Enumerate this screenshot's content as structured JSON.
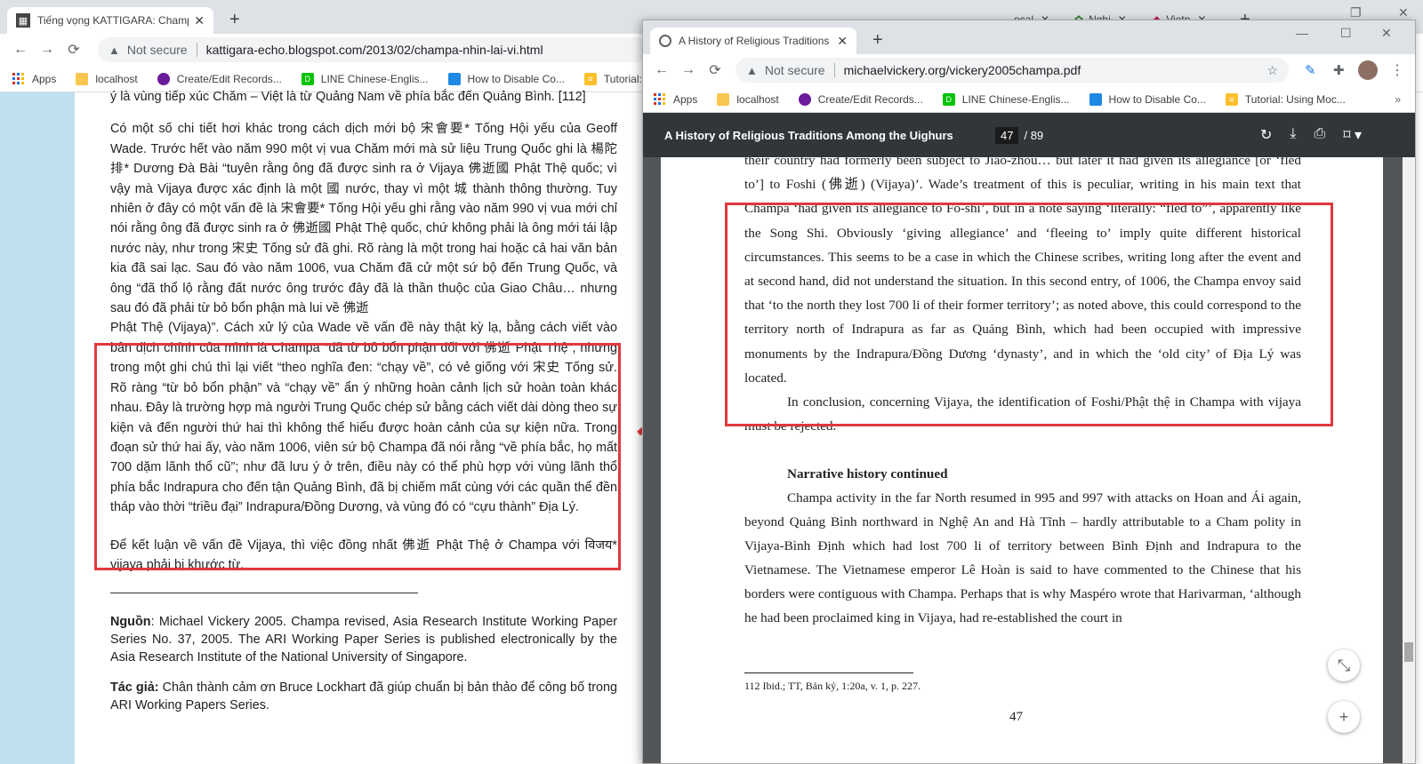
{
  "back_window": {
    "tab_title": "Tiếng vọng KATTIGARA: Champa",
    "url_security": "Not secure",
    "url": "kattigara-echo.blogspot.com/2013/02/champa-nhin-lai-vi.html",
    "bg_tabs": [
      "ocal",
      "Nghi",
      "Vietn"
    ],
    "bookmarks": [
      "Apps",
      "localhost",
      "Create/Edit Records...",
      "LINE Chinese-Englis...",
      "How to Disable Co...",
      "Tutorial: Usin"
    ],
    "paragraphs": [
      "ý là vùng tiếp xúc Chăm – Việt là từ Quảng Nam về phía bắc đến Quảng Bình. [112]",
      "Có một số chi tiết hơi khác trong cách dịch mới bộ 宋會要* Tống Hội yếu của Geoff Wade. Trước hết vào năm 990 một vị vua Chăm mới mà sử liệu Trung Quốc ghi là 楊陀排* Dương Đà Bài “tuyên rằng ông đã được sinh ra ở Vijaya 佛逝國 Phật Thệ quốc; vì vậy mà Vijaya được xác định là một 國 nước, thay vì một 城 thành thông thường. Tuy nhiên ở đây có một vấn đề là 宋會要* Tống Hội yếu ghi rằng vào năm 990 vị vua mới chỉ nói rằng ông đã được sinh ra ở 佛逝國 Phật Thệ quốc, chứ không phải là ông mới tái lập nước này, như trong 宋史 Tống sử đã ghi. Rõ ràng là một trong hai hoặc cả hai văn bản kia đã sai lạc. Sau đó vào năm 1006, vua Chăm đã cử một sứ bộ đến Trung Quốc, và ông “đã thổ lộ rằng đất nước ông trước đây đã là thần thuộc của Giao Châu… nhưng sau đó đã phải từ bỏ bổn phận mà lui về 佛逝",
      "Phật Thệ (Vijaya)”. Cách xử lý của Wade về vấn đề này thật kỳ lạ, bằng cách viết vào bản dịch chính của mình là Champa “đã từ bỏ bổn phận đối với 佛逝 Phật Thệ”, nhưng trong một ghi chú thì lại viết “theo nghĩa đen: “chạy về”, có vẻ giống với 宋史 Tống sử. Rõ ràng “từ bỏ bổn phận” và “chạy về” ẩn ý những hoàn cảnh lịch sử hoàn toàn khác nhau. Đây là trường hợp mà người Trung Quốc chép sử bằng cách viết dài dòng theo sự kiện và đến người thứ hai thì không thể hiểu được hoàn cảnh của sự kiện nữa. Trong đoạn sử thứ hai ấy, vào năm 1006, viên sứ bộ Champa đã nói rằng “về phía bắc, họ mất 700 dặm lãnh thổ cũ”; như đã lưu ý ở trên, điều này có thể phù hợp với vùng lãnh thổ phía bắc Indrapura cho đến tận Quảng Bình, đã bị chiếm mất cùng với các quần thể đền tháp vào thời “triều đại” Indrapura/Đồng Dương, và vùng đó có “cựu thành” Địa Lý.",
      "Để kết luận về vấn đề Vijaya, thì việc đồng nhất 佛逝 Phật Thệ ở Champa với विजय* vijaya phải bị khước từ."
    ],
    "source_label": "Nguồn",
    "source_text": ": Michael Vickery 2005. Champa revised, Asia Research Institute Working Paper Series No. 37, 2005. The ARI Working Paper Series is published electronically by the Asia Research Institute of the National University of Singapore.",
    "author_label": "Tác giả:",
    "author_text": " Chân thành cảm ơn Bruce Lockhart đã giúp chuẩn bị bản thảo để công bố trong ARI Working Papers Series."
  },
  "front_window": {
    "tab_title": "A History of Religious Traditions",
    "url_security": "Not secure",
    "url": "michaelvickery.org/vickery2005champa.pdf",
    "bookmarks": [
      "Apps",
      "localhost",
      "Create/Edit Records...",
      "LINE Chinese-Englis...",
      "How to Disable Co...",
      "Tutorial: Using Moc..."
    ],
    "pdf_title": "A History of Religious Traditions Among the Uighurs",
    "page_current": "47",
    "page_total": "/ 89",
    "lines_top": "their country had formerly been subject to Jiao-zhou… but later it had given its allegiance [or ‘fled to’] to Foshi (佛逝) (Vijaya)’. Wade’s treatment of this is peculiar, writing in his main text that Champa ‘had given its allegiance to Fo-shi’, but in a note saying ‘literally: “fled to”’, apparently like the Song Shi. Obviously ‘giving allegiance’ and ‘fleeing to’ imply quite different historical circumstances. This seems to be a case in which the Chinese scribes, writing long after the event and at second hand, did not understand the situation. In this second entry, of 1006, the Champa envoy said that ‘to the north they lost 700 li of their former territory’; as noted above, this could correspond to the territory north of Indrapura as far as Quảng Bình, which had been occupied with impressive monuments by the Indrapura/Đồng Dương ‘dynasty’, and in which the ‘old city’ of Địa Lý was located.",
    "conclusion": "In conclusion, concerning Vijaya, the identification of Foshi/Phật thệ in Champa with vijaya must be rejected.",
    "heading": "Narrative history continued",
    "narrative": "Champa activity in the far North resumed in 995 and 997 with attacks on Hoan and Ái again, beyond Quảng Bình northward in Nghệ An and Hà Tĩnh – hardly attributable to a Cham polity in Vijaya-Bình Định which had lost 700 li of territory between Bình Định and Indrapura to the Vietnamese. The Vietnamese emperor Lê Hoàn is said to have commented to the Chinese that his borders were contiguous with Champa. Perhaps that is why Maspéro wrote that Harivarman, ‘although he had been proclaimed king in Vijaya, had re-established the court in",
    "footnote": "112 Ibid.; TT, Bản kỷ, 1:20a, v. 1, p. 227.",
    "page_number": "47"
  },
  "colors": {
    "highlight": "#e0393e",
    "pdf_toolbar": "#323639",
    "blog_sidebar": "#bfe0ef"
  }
}
